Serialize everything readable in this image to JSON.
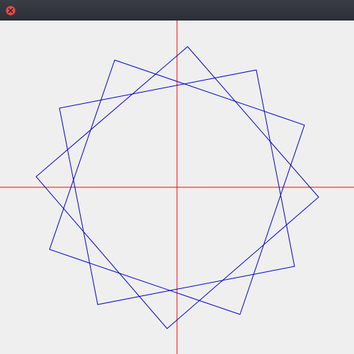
{
  "window": {
    "title": "",
    "close_icon": "close-icon",
    "close_color": "#e0504a"
  },
  "canvas": {
    "background": "#efefef",
    "axes_color": "#ff0000",
    "shape_color": "#0000cc",
    "shapes": [
      {
        "name": "rotated-square-1",
        "vertices": 4
      },
      {
        "name": "rotated-square-2",
        "vertices": 4
      },
      {
        "name": "rotated-square-3",
        "vertices": 4
      }
    ]
  }
}
